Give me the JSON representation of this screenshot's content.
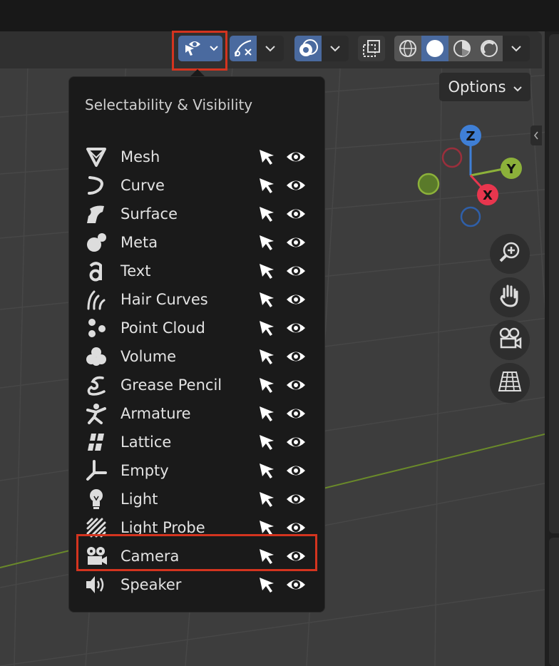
{
  "header": {
    "options_label": "Options",
    "icons": {
      "selectability": "cursor-eye-icon",
      "gizmo": "gizmo-icon",
      "overlay": "overlay-icon",
      "xray": "xray-icon",
      "shading": [
        "wireframe-icon",
        "solid-icon",
        "material-preview-icon",
        "rendered-icon"
      ]
    }
  },
  "nav_gizmo": {
    "z": "Z",
    "y": "Y",
    "x": "X"
  },
  "nav_buttons": [
    "zoom-icon",
    "pan-hand-icon",
    "camera-view-icon",
    "ortho-grid-icon"
  ],
  "popup": {
    "title": "Selectability & Visibility",
    "items": [
      {
        "label": "Mesh",
        "icon": "mesh-icon"
      },
      {
        "label": "Curve",
        "icon": "curve-icon"
      },
      {
        "label": "Surface",
        "icon": "surface-icon"
      },
      {
        "label": "Meta",
        "icon": "meta-icon"
      },
      {
        "label": "Text",
        "icon": "text-icon"
      },
      {
        "label": "Hair Curves",
        "icon": "hair-curves-icon"
      },
      {
        "label": "Point Cloud",
        "icon": "point-cloud-icon"
      },
      {
        "label": "Volume",
        "icon": "volume-icon"
      },
      {
        "label": "Grease Pencil",
        "icon": "grease-pencil-icon"
      },
      {
        "label": "Armature",
        "icon": "armature-icon"
      },
      {
        "label": "Lattice",
        "icon": "lattice-icon"
      },
      {
        "label": "Empty",
        "icon": "empty-icon"
      },
      {
        "label": "Light",
        "icon": "light-icon"
      },
      {
        "label": "Light Probe",
        "icon": "light-probe-icon"
      },
      {
        "label": "Camera",
        "icon": "camera-icon"
      },
      {
        "label": "Speaker",
        "icon": "speaker-icon"
      }
    ]
  },
  "colors": {
    "accent": "#4a6a9f",
    "highlight": "#d4341f",
    "axis_x": "#e8364e",
    "axis_y": "#8cb13a",
    "axis_z": "#3f7fd6"
  }
}
